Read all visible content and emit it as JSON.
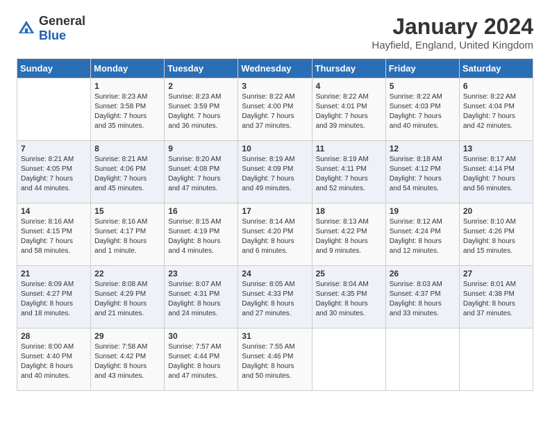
{
  "header": {
    "logo_general": "General",
    "logo_blue": "Blue",
    "month_year": "January 2024",
    "location": "Hayfield, England, United Kingdom"
  },
  "weekdays": [
    "Sunday",
    "Monday",
    "Tuesday",
    "Wednesday",
    "Thursday",
    "Friday",
    "Saturday"
  ],
  "weeks": [
    [
      {
        "day": "",
        "info": ""
      },
      {
        "day": "1",
        "info": "Sunrise: 8:23 AM\nSunset: 3:58 PM\nDaylight: 7 hours\nand 35 minutes."
      },
      {
        "day": "2",
        "info": "Sunrise: 8:23 AM\nSunset: 3:59 PM\nDaylight: 7 hours\nand 36 minutes."
      },
      {
        "day": "3",
        "info": "Sunrise: 8:22 AM\nSunset: 4:00 PM\nDaylight: 7 hours\nand 37 minutes."
      },
      {
        "day": "4",
        "info": "Sunrise: 8:22 AM\nSunset: 4:01 PM\nDaylight: 7 hours\nand 39 minutes."
      },
      {
        "day": "5",
        "info": "Sunrise: 8:22 AM\nSunset: 4:03 PM\nDaylight: 7 hours\nand 40 minutes."
      },
      {
        "day": "6",
        "info": "Sunrise: 8:22 AM\nSunset: 4:04 PM\nDaylight: 7 hours\nand 42 minutes."
      }
    ],
    [
      {
        "day": "7",
        "info": "Sunrise: 8:21 AM\nSunset: 4:05 PM\nDaylight: 7 hours\nand 44 minutes."
      },
      {
        "day": "8",
        "info": "Sunrise: 8:21 AM\nSunset: 4:06 PM\nDaylight: 7 hours\nand 45 minutes."
      },
      {
        "day": "9",
        "info": "Sunrise: 8:20 AM\nSunset: 4:08 PM\nDaylight: 7 hours\nand 47 minutes."
      },
      {
        "day": "10",
        "info": "Sunrise: 8:19 AM\nSunset: 4:09 PM\nDaylight: 7 hours\nand 49 minutes."
      },
      {
        "day": "11",
        "info": "Sunrise: 8:19 AM\nSunset: 4:11 PM\nDaylight: 7 hours\nand 52 minutes."
      },
      {
        "day": "12",
        "info": "Sunrise: 8:18 AM\nSunset: 4:12 PM\nDaylight: 7 hours\nand 54 minutes."
      },
      {
        "day": "13",
        "info": "Sunrise: 8:17 AM\nSunset: 4:14 PM\nDaylight: 7 hours\nand 56 minutes."
      }
    ],
    [
      {
        "day": "14",
        "info": "Sunrise: 8:16 AM\nSunset: 4:15 PM\nDaylight: 7 hours\nand 58 minutes."
      },
      {
        "day": "15",
        "info": "Sunrise: 8:16 AM\nSunset: 4:17 PM\nDaylight: 8 hours\nand 1 minute."
      },
      {
        "day": "16",
        "info": "Sunrise: 8:15 AM\nSunset: 4:19 PM\nDaylight: 8 hours\nand 4 minutes."
      },
      {
        "day": "17",
        "info": "Sunrise: 8:14 AM\nSunset: 4:20 PM\nDaylight: 8 hours\nand 6 minutes."
      },
      {
        "day": "18",
        "info": "Sunrise: 8:13 AM\nSunset: 4:22 PM\nDaylight: 8 hours\nand 9 minutes."
      },
      {
        "day": "19",
        "info": "Sunrise: 8:12 AM\nSunset: 4:24 PM\nDaylight: 8 hours\nand 12 minutes."
      },
      {
        "day": "20",
        "info": "Sunrise: 8:10 AM\nSunset: 4:26 PM\nDaylight: 8 hours\nand 15 minutes."
      }
    ],
    [
      {
        "day": "21",
        "info": "Sunrise: 8:09 AM\nSunset: 4:27 PM\nDaylight: 8 hours\nand 18 minutes."
      },
      {
        "day": "22",
        "info": "Sunrise: 8:08 AM\nSunset: 4:29 PM\nDaylight: 8 hours\nand 21 minutes."
      },
      {
        "day": "23",
        "info": "Sunrise: 8:07 AM\nSunset: 4:31 PM\nDaylight: 8 hours\nand 24 minutes."
      },
      {
        "day": "24",
        "info": "Sunrise: 8:05 AM\nSunset: 4:33 PM\nDaylight: 8 hours\nand 27 minutes."
      },
      {
        "day": "25",
        "info": "Sunrise: 8:04 AM\nSunset: 4:35 PM\nDaylight: 8 hours\nand 30 minutes."
      },
      {
        "day": "26",
        "info": "Sunrise: 8:03 AM\nSunset: 4:37 PM\nDaylight: 8 hours\nand 33 minutes."
      },
      {
        "day": "27",
        "info": "Sunrise: 8:01 AM\nSunset: 4:38 PM\nDaylight: 8 hours\nand 37 minutes."
      }
    ],
    [
      {
        "day": "28",
        "info": "Sunrise: 8:00 AM\nSunset: 4:40 PM\nDaylight: 8 hours\nand 40 minutes."
      },
      {
        "day": "29",
        "info": "Sunrise: 7:58 AM\nSunset: 4:42 PM\nDaylight: 8 hours\nand 43 minutes."
      },
      {
        "day": "30",
        "info": "Sunrise: 7:57 AM\nSunset: 4:44 PM\nDaylight: 8 hours\nand 47 minutes."
      },
      {
        "day": "31",
        "info": "Sunrise: 7:55 AM\nSunset: 4:46 PM\nDaylight: 8 hours\nand 50 minutes."
      },
      {
        "day": "",
        "info": ""
      },
      {
        "day": "",
        "info": ""
      },
      {
        "day": "",
        "info": ""
      }
    ]
  ]
}
